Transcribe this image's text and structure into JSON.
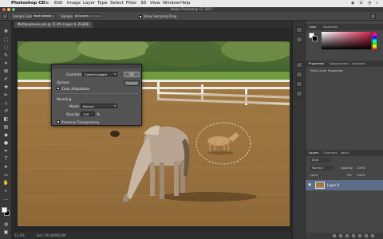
{
  "menubar": {
    "app_name": "Photoshop CC",
    "items": [
      "File",
      "Edit",
      "Image",
      "Layer",
      "Type",
      "Select",
      "Filter",
      "3D",
      "View",
      "Window",
      "Help"
    ]
  },
  "titlebar": {
    "title": "Adobe Photoshop CC 2017"
  },
  "options": {
    "sample_size_label": "Sample Size:",
    "sample_size_value": "Point Sample",
    "sample_label": "Sample:",
    "sample_value": "All Layers",
    "show_ring_label": "Show Sampling Ring"
  },
  "document": {
    "tab_title": "Mothergroove.psd @ 11.9% (Layer 0, RGB/8)",
    "zoom": "11.9%",
    "doc_info": "Doc: 60.6M/60.6M"
  },
  "dialog": {
    "contents_label": "Contents:",
    "contents_value": "Content-Aware",
    "options_heading": "Options",
    "color_adaptation_label": "Color Adaptation",
    "blending_heading": "Blending",
    "mode_label": "Mode:",
    "mode_value": "Normal",
    "opacity_label": "Opacity:",
    "opacity_value": "100",
    "opacity_unit": "%",
    "preserve_label": "Preserve Transparency",
    "ok_label": "OK",
    "cancel_label": "Cancel"
  },
  "color_panel": {
    "tabs": [
      "Color",
      "Swatches"
    ]
  },
  "properties_panel": {
    "tabs": [
      "Properties",
      "Adjustments",
      "Libraries"
    ],
    "subtitle": "Pixel Layer Properties"
  },
  "layers_panel": {
    "tabs": [
      "Layers",
      "Channels",
      "Paths"
    ],
    "kind_label": "Kind",
    "blend_mode": "Normal",
    "opacity_label": "Opacity:",
    "opacity_value": "100%",
    "lock_label": "Lock:",
    "fill_label": "Fill:",
    "fill_value": "100%",
    "layer_name": "Layer 0"
  },
  "colors": {
    "accent": "#5d6d87",
    "panel": "#464646",
    "dialog": "#535353"
  }
}
